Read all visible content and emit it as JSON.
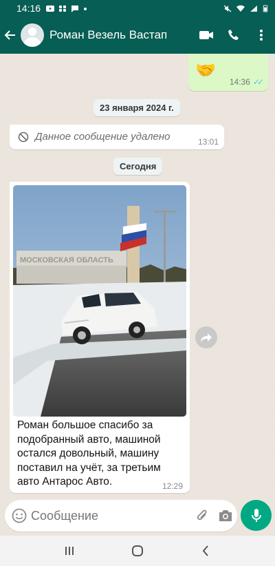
{
  "status_bar": {
    "time": "14:16"
  },
  "header": {
    "contact_name": "Роман Везель Вастап"
  },
  "messages": {
    "outgoing_sticker": {
      "emoji": "🤝",
      "time": "14:36"
    },
    "date_chip_1": "23 января 2024 г.",
    "deleted": {
      "text": "Данное сообщение удалено",
      "time": "13:01"
    },
    "date_chip_2": "Сегодня",
    "photo_message": {
      "photo_sign": "МОСКОВСКАЯ ОБЛАСТЬ",
      "caption": "Роман большое спасибо за подобранный авто, машиной остался довольный, машину поставил на учёт, за третьим авто Антарос Авто.",
      "time": "12:29"
    }
  },
  "input": {
    "placeholder": "Сообщение"
  },
  "colors": {
    "header": "#075E54",
    "chat_bg": "#ECE5DD",
    "out_bubble": "#DCF8C6",
    "accent": "#00A884",
    "read_ticks": "#4FC3F7"
  },
  "icons": [
    "back-arrow-icon",
    "avatar-icon",
    "video-call-icon",
    "phone-icon",
    "more-menu-icon",
    "blocked-icon",
    "forward-icon",
    "emoji-icon",
    "attach-icon",
    "camera-icon",
    "mic-icon",
    "recents-icon",
    "home-icon",
    "back-nav-icon"
  ]
}
